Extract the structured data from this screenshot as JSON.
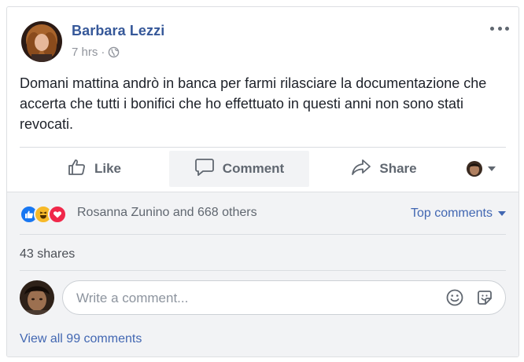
{
  "post": {
    "author": "Barbara Lezzi",
    "time": "7 hrs",
    "separator": "·",
    "privacy_icon": "globe-icon",
    "more_icon": "more-options-icon",
    "text": "Domani mattina andrò in banca per farmi rilasciare la documentazione che accerta che tutti i bonifici che ho effettuato in questi anni non sono stati revocati."
  },
  "actions": {
    "like_label": "Like",
    "comment_label": "Comment",
    "share_label": "Share"
  },
  "reactions": {
    "icons": [
      "like-icon",
      "haha-icon",
      "love-icon"
    ],
    "summary": "Rosanna Zunino and 668 others",
    "sort_label": "Top comments"
  },
  "shares": "43 shares",
  "comment_input": {
    "placeholder": "Write a comment...",
    "emoji_icon": "emoji-icon",
    "sticker_icon": "sticker-icon"
  },
  "view_all": "View all 99 comments",
  "colors": {
    "link_blue": "#365899",
    "action_blue": "#4267b2",
    "gray_text": "#606770",
    "like_blue": "#1877f2",
    "love_red": "#f0284a",
    "haha_yellow": "#f7b928"
  }
}
